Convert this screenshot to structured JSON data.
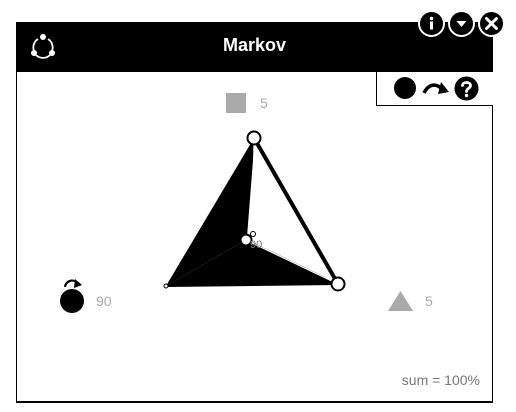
{
  "window": {
    "title": "Markov",
    "controls": [
      {
        "name": "info-button",
        "icon": "info-icon"
      },
      {
        "name": "menu-button",
        "icon": "caret-down-icon"
      },
      {
        "name": "close-button",
        "icon": "close-icon"
      }
    ]
  },
  "toolbar": {
    "tools": [
      {
        "name": "circle-tool",
        "icon": "filled-circle-icon"
      },
      {
        "name": "step-tool",
        "icon": "curved-arrow-icon"
      },
      {
        "name": "help-tool",
        "icon": "question-icon"
      }
    ]
  },
  "states": {
    "square": {
      "icon": "square-icon",
      "value": "5",
      "color": "#aaaaaa"
    },
    "circle": {
      "icon": "circle-icon",
      "value": "90",
      "color": "#000000"
    },
    "triangle": {
      "icon": "triangle-icon",
      "value": "5",
      "color": "#aaaaaa"
    }
  },
  "center_label": "90",
  "footer": {
    "sum_text": "sum = 100%"
  }
}
